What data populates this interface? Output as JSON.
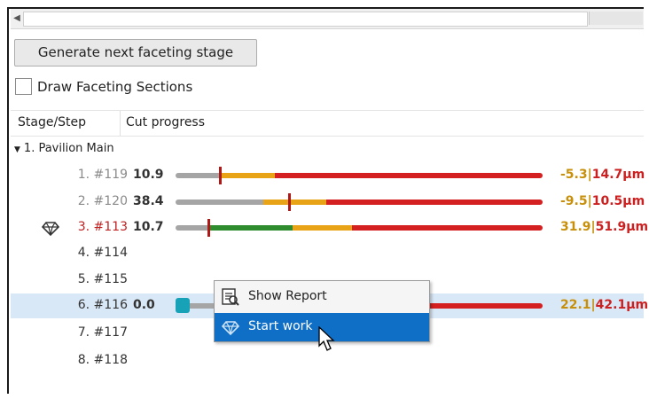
{
  "toolbar": {
    "generate_label": "Generate next faceting stage"
  },
  "options": {
    "draw_sections_label": "Draw Faceting Sections",
    "draw_sections_checked": false
  },
  "table": {
    "headers": [
      "Stage/Step",
      "Cut progress"
    ],
    "group_label": "1. Pavilion Main",
    "rows": [
      {
        "step": "1.",
        "id": "#119",
        "value": "10.9",
        "left_value": "-5.3",
        "right_value": "14.7",
        "unit": "μm",
        "state": "done",
        "progress_marker": 0.12
      },
      {
        "step": "2.",
        "id": "#120",
        "value": "38.4",
        "left_value": "-9.5",
        "right_value": "10.5",
        "unit": "μm",
        "state": "done",
        "progress_marker": 0.31
      },
      {
        "step": "3.",
        "id": "#113",
        "value": "10.7",
        "left_value": "31.9",
        "right_value": "51.9",
        "unit": "μm",
        "state": "active",
        "progress_marker": 0.095
      },
      {
        "step": "4.",
        "id": "#114",
        "value": "",
        "state": "pending"
      },
      {
        "step": "5.",
        "id": "#115",
        "value": "",
        "state": "pending"
      },
      {
        "step": "6.",
        "id": "#116",
        "value": "0.0",
        "left_value": "22.1",
        "right_value": "42.1",
        "unit": "μm",
        "state": "selected"
      },
      {
        "step": "7.",
        "id": "#117",
        "value": "",
        "state": "pending"
      },
      {
        "step": "8.",
        "id": "#118",
        "value": "",
        "state": "pending"
      }
    ]
  },
  "context_menu": {
    "items": [
      {
        "label": "Show Report",
        "icon": "report-icon"
      },
      {
        "label": "Start work",
        "icon": "diamond-icon",
        "highlighted": true
      }
    ]
  },
  "colors": {
    "grey": "#9a9a9a",
    "orange": "#e8a317",
    "red": "#d42020",
    "green": "#2e8b2e",
    "teal": "#17a2b8",
    "highlight": "#0f6fc6",
    "selection": "#d9e8f7"
  }
}
